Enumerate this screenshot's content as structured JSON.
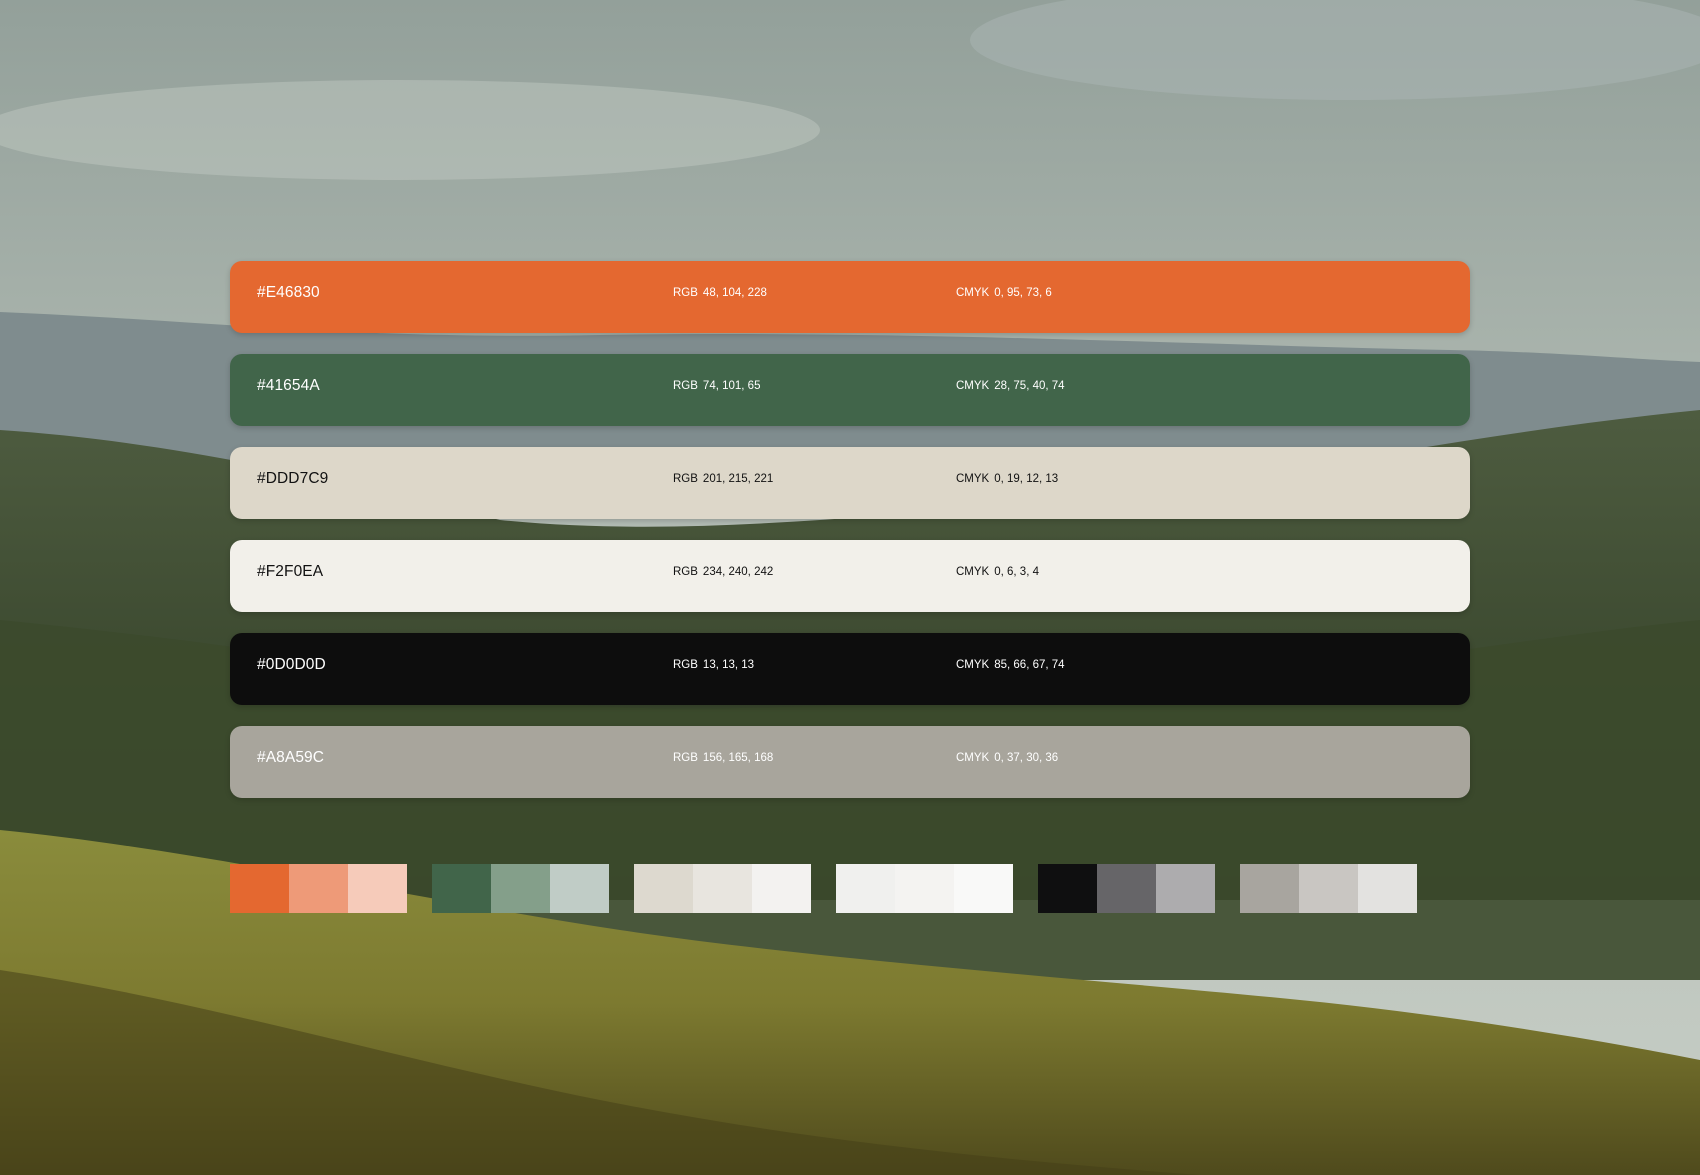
{
  "palette": [
    {
      "hex": "#E46830",
      "rgb_label": "RGB",
      "rgb": "48, 104, 228",
      "cmyk_label": "CMYK",
      "cmyk": "0, 95, 73, 6",
      "text_color": "#ffffff",
      "bar_color": "#E46830"
    },
    {
      "hex": "#41654A",
      "rgb_label": "RGB",
      "rgb": "74, 101, 65",
      "cmyk_label": "CMYK",
      "cmyk": "28, 75, 40, 74",
      "text_color": "#ffffff",
      "bar_color": "#41654A"
    },
    {
      "hex": "#DDD7C9",
      "rgb_label": "RGB",
      "rgb": "201, 215, 221",
      "cmyk_label": "CMYK",
      "cmyk": "0, 19, 12, 13",
      "text_color": "#111111",
      "bar_color": "#DDD7C9"
    },
    {
      "hex": "#F2F0EA",
      "rgb_label": "RGB",
      "rgb": "234, 240, 242",
      "cmyk_label": "CMYK",
      "cmyk": "0, 6, 3, 4",
      "text_color": "#111111",
      "bar_color": "#F2F0EA"
    },
    {
      "hex": "#0D0D0D",
      "rgb_label": "RGB",
      "rgb": "13, 13, 13",
      "cmyk_label": "CMYK",
      "cmyk": "85, 66, 67, 74",
      "text_color": "#ffffff",
      "bar_color": "#0D0D0D"
    },
    {
      "hex": "#A8A59C",
      "rgb_label": "RGB",
      "rgb": "156, 165, 168",
      "cmyk_label": "CMYK",
      "cmyk": "0, 37, 30, 36",
      "text_color": "#ffffff",
      "bar_color": "#A8A59C"
    }
  ],
  "tint_groups": [
    [
      "#E46830",
      "#EE9A78",
      "#F6CBBA"
    ],
    [
      "#41654A",
      "#849F8A",
      "#C0CCC6"
    ],
    [
      "#DDD9CF",
      "#E8E5DF",
      "#F3F2F0"
    ],
    [
      "#F0F0EE",
      "#F4F3F1",
      "#F9F9F8"
    ],
    [
      "#0F0F10",
      "#666568",
      "#ADACAE"
    ],
    [
      "#A8A59F",
      "#C9C6C2",
      "#E3E2E0"
    ]
  ]
}
